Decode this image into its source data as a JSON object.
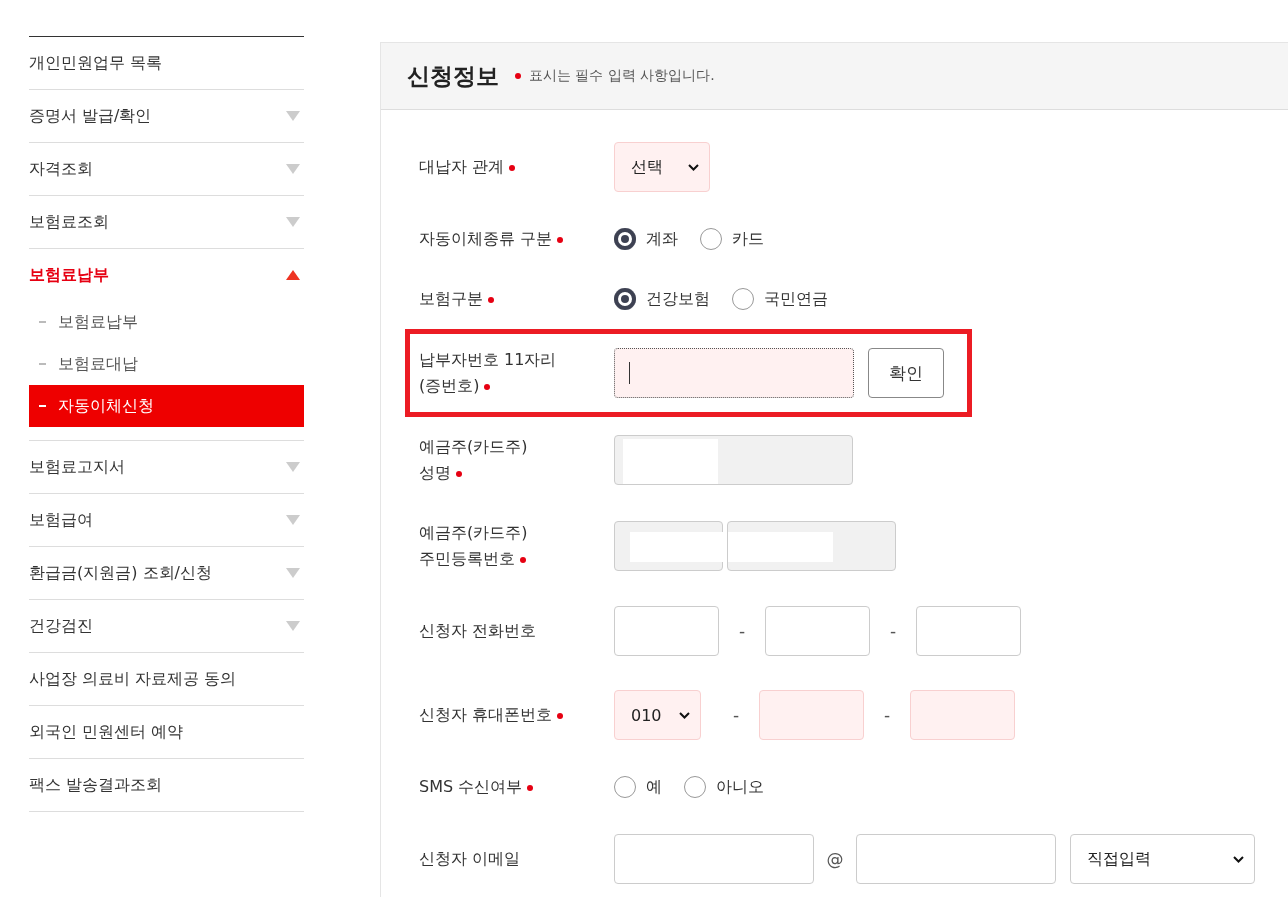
{
  "sidebar": {
    "items": [
      {
        "label": "개인민원업무 목록",
        "has_submenu": false,
        "expanded": false
      },
      {
        "label": "증명서 발급/확인",
        "has_submenu": true,
        "expanded": false
      },
      {
        "label": "자격조회",
        "has_submenu": true,
        "expanded": false
      },
      {
        "label": "보험료조회",
        "has_submenu": true,
        "expanded": false
      },
      {
        "label": "보험료납부",
        "has_submenu": true,
        "expanded": true,
        "children": [
          {
            "label": "보험료납부",
            "selected": false
          },
          {
            "label": "보험료대납",
            "selected": false
          },
          {
            "label": "자동이체신청",
            "selected": true
          }
        ]
      },
      {
        "label": "보험료고지서",
        "has_submenu": true,
        "expanded": false
      },
      {
        "label": "보험급여",
        "has_submenu": true,
        "expanded": false
      },
      {
        "label": "환급금(지원금) 조회/신청",
        "has_submenu": true,
        "expanded": false
      },
      {
        "label": "건강검진",
        "has_submenu": true,
        "expanded": false
      },
      {
        "label": "사업장 의료비 자료제공 동의",
        "has_submenu": false,
        "expanded": false
      },
      {
        "label": "외국인 민원센터 예약",
        "has_submenu": false,
        "expanded": false
      },
      {
        "label": "팩스 발송결과조회",
        "has_submenu": false,
        "expanded": false
      }
    ]
  },
  "form": {
    "title": "신청정보",
    "note": "표시는 필수 입력 사항입니다.",
    "rows": [
      {
        "kind": "select",
        "label": "대납자 관계",
        "required": true,
        "value": "선택"
      },
      {
        "kind": "radio",
        "label": "자동이체종류 구분",
        "required": true,
        "options": [
          {
            "label": "계좌",
            "selected": true
          },
          {
            "label": "카드",
            "selected": false
          }
        ]
      },
      {
        "kind": "radio",
        "label": "보험구분",
        "required": true,
        "options": [
          {
            "label": "건강보험",
            "selected": true
          },
          {
            "label": "국민연금",
            "selected": false
          }
        ]
      },
      {
        "kind": "input-button",
        "label": "납부자번호 11자리\n(증번호)",
        "required": true,
        "highlighted": true,
        "button": "확인"
      },
      {
        "kind": "disabled",
        "label": "예금주(카드주)\n성명",
        "required": true
      },
      {
        "kind": "disabled-split",
        "label": "예금주(카드주)\n주민등록번호",
        "required": true
      },
      {
        "kind": "phone",
        "label": "신청자 전화번호",
        "required": false,
        "separator": "-"
      },
      {
        "kind": "mobile",
        "label": "신청자 휴대폰번호",
        "required": true,
        "value": "010",
        "separator": "-"
      },
      {
        "kind": "radio",
        "label": "SMS 수신여부",
        "required": true,
        "options": [
          {
            "label": "예",
            "selected": false
          },
          {
            "label": "아니오",
            "selected": false
          }
        ]
      },
      {
        "kind": "email",
        "label": "신청자 이메일",
        "required": false,
        "at": "@",
        "domain": "직접입력"
      }
    ]
  }
}
